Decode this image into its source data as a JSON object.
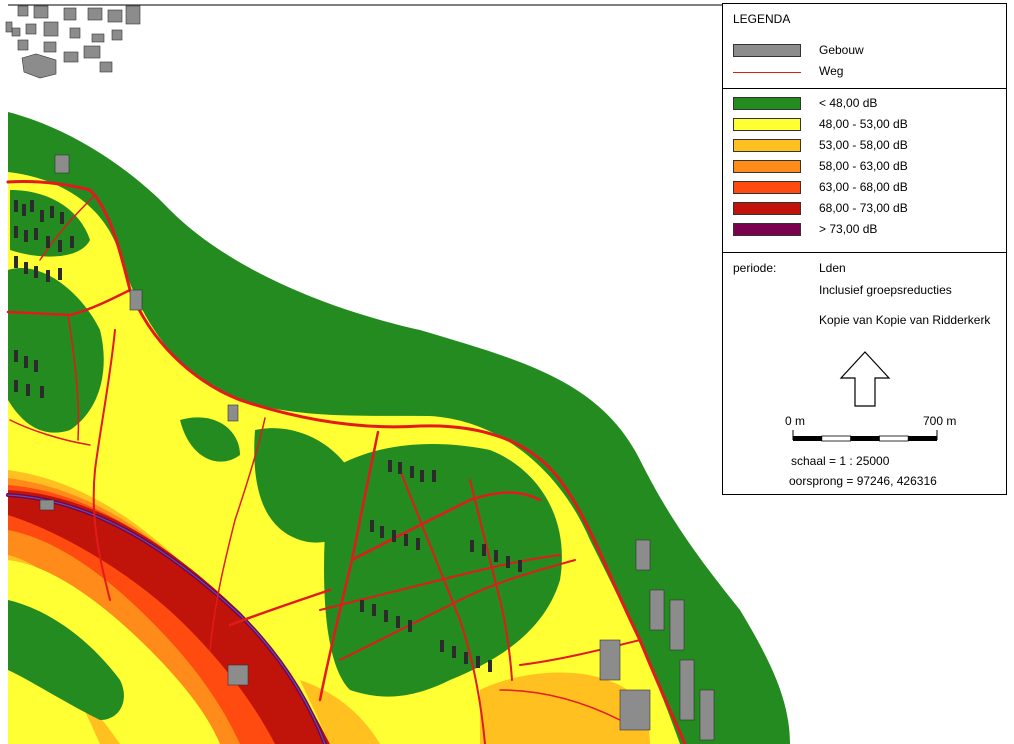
{
  "legend": {
    "title": "LEGENDA",
    "base_items": [
      {
        "label": "Gebouw",
        "kind": "building",
        "color": "#8c8c8c"
      },
      {
        "label": "Weg",
        "kind": "road",
        "color": "#e31a1c"
      }
    ],
    "noise_classes": [
      {
        "label": "< 48,00 dB",
        "color": "#238b1f"
      },
      {
        "label": "48,00 - 53,00 dB",
        "color": "#ffff33"
      },
      {
        "label": "53,00 - 58,00 dB",
        "color": "#ffc020"
      },
      {
        "label": "58,00 - 63,00 dB",
        "color": "#ff8c1a"
      },
      {
        "label": "63,00 - 68,00 dB",
        "color": "#ff4a10"
      },
      {
        "label": "68,00 - 73,00 dB",
        "color": "#c0140a"
      },
      {
        "label": "> 73,00 dB",
        "color": "#7a0050"
      }
    ],
    "periode_label": "periode:",
    "periode_value": "Lden",
    "note": "Inclusief groepsreducties",
    "project": "Kopie van Kopie van Ridderkerk",
    "north_icon": "north-arrow-icon",
    "scalebar": {
      "start_label": "0 m",
      "end_label": "700 m",
      "scale_text": "schaal = 1 : 25000",
      "origin_text": "oorsprong = 97246, 426316"
    }
  }
}
